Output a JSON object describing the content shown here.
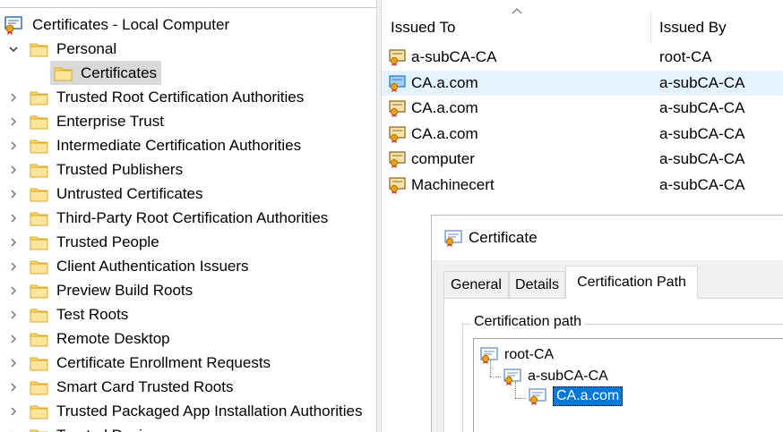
{
  "tree": {
    "root_label": "Certificates - Local Computer",
    "personal_label": "Personal",
    "certificates_label": "Certificates",
    "items": [
      "Trusted Root Certification Authorities",
      "Enterprise Trust",
      "Intermediate Certification Authorities",
      "Trusted Publishers",
      "Untrusted Certificates",
      "Third-Party Root Certification Authorities",
      "Trusted People",
      "Client Authentication Issuers",
      "Preview Build Roots",
      "Test Roots",
      "Remote Desktop",
      "Certificate Enrollment Requests",
      "Smart Card Trusted Roots",
      "Trusted Packaged App Installation Authorities",
      "Trusted Devices"
    ]
  },
  "list": {
    "columns": {
      "issued_to": "Issued To",
      "issued_by": "Issued By"
    },
    "rows": [
      {
        "issued_to": "a-subCA-CA",
        "issued_by": "root-CA",
        "icon": "certificate-icon"
      },
      {
        "issued_to": "CA.a.com",
        "issued_by": "a-subCA-CA",
        "icon": "certificate-icon-selected"
      },
      {
        "issued_to": "CA.a.com",
        "issued_by": "a-subCA-CA",
        "icon": "certificate-icon"
      },
      {
        "issued_to": "CA.a.com",
        "issued_by": "a-subCA-CA",
        "icon": "certificate-icon"
      },
      {
        "issued_to": "computer",
        "issued_by": "a-subCA-CA",
        "icon": "certificate-icon"
      },
      {
        "issued_to": "Machinecert",
        "issued_by": "a-subCA-CA",
        "icon": "certificate-icon"
      }
    ]
  },
  "dialog": {
    "title": "Certificate",
    "tabs": [
      "General",
      "Details",
      "Certification Path"
    ],
    "active_tab": "Certification Path",
    "group_label": "Certification path",
    "path": [
      "root-CA",
      "a-subCA-CA",
      "CA.a.com"
    ]
  },
  "colors": {
    "folder_yellow": "#ffd86e",
    "row_highlight": "#e5f3ff",
    "path_selection": "#0078d7",
    "tree_selection": "#d9d9d9"
  }
}
